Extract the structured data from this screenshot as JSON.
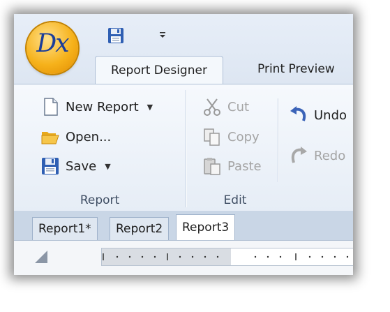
{
  "app": {
    "logo_text": "Dx"
  },
  "quick_access": {
    "save_icon": "floppy-disk-icon",
    "customize_icon": "chevron-down-icon"
  },
  "tabs": [
    {
      "label": "Report Designer",
      "active": true
    },
    {
      "label": "Print Preview",
      "active": false
    }
  ],
  "ribbon": {
    "report_group": {
      "label": "Report",
      "new_report": "New Report",
      "open": "Open...",
      "save": "Save"
    },
    "edit_group": {
      "label": "Edit",
      "cut": "Cut",
      "copy": "Copy",
      "paste": "Paste",
      "undo": "Undo",
      "redo": "Redo"
    }
  },
  "document_tabs": [
    {
      "label": "Report1*",
      "active": false
    },
    {
      "label": "Report2",
      "active": false
    },
    {
      "label": "Report3",
      "active": true
    }
  ],
  "colors": {
    "accent": "#f6b21b",
    "ribbon_bg": "#eef3f9",
    "logo_text": "#1b3e9a"
  }
}
